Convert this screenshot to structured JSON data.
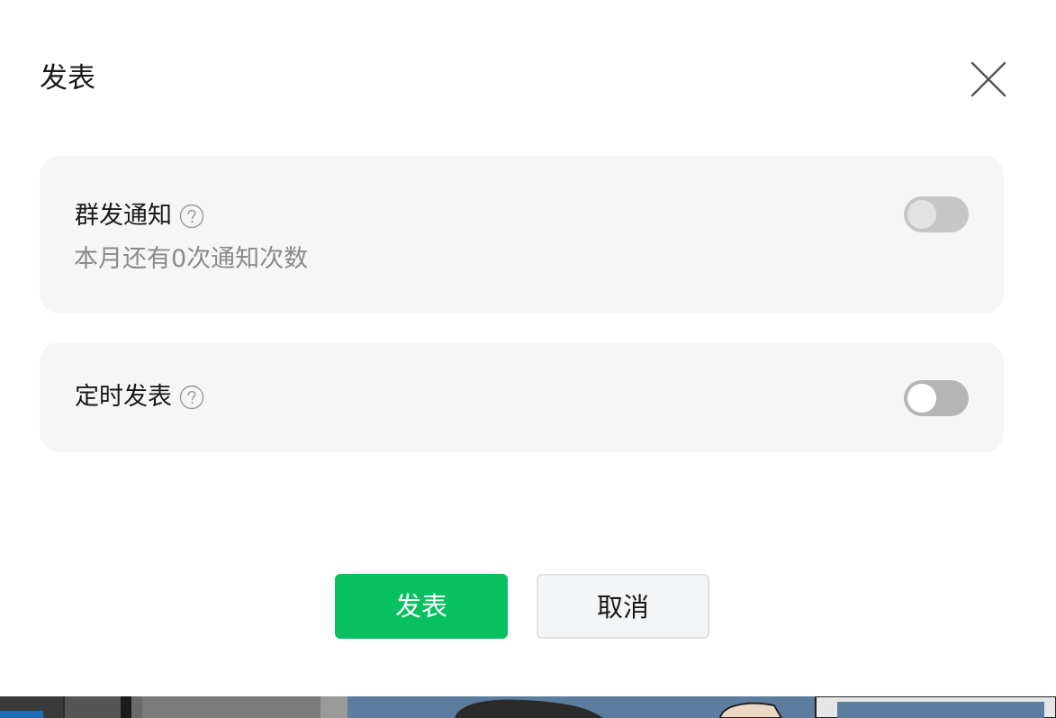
{
  "dialog": {
    "title": "发表",
    "close_icon": "close-icon"
  },
  "options": {
    "notify": {
      "label": "群发通知",
      "help_icon": "question-circle-icon",
      "sub_text": "本月还有0次通知次数",
      "enabled": false
    },
    "schedule": {
      "label": "定时发表",
      "help_icon": "question-circle-icon",
      "enabled": false
    }
  },
  "actions": {
    "publish_label": "发表",
    "cancel_label": "取消"
  },
  "colors": {
    "primary": "#07c160",
    "card_bg": "#f6f6f6",
    "toggle_off": "#b7b7b7"
  }
}
